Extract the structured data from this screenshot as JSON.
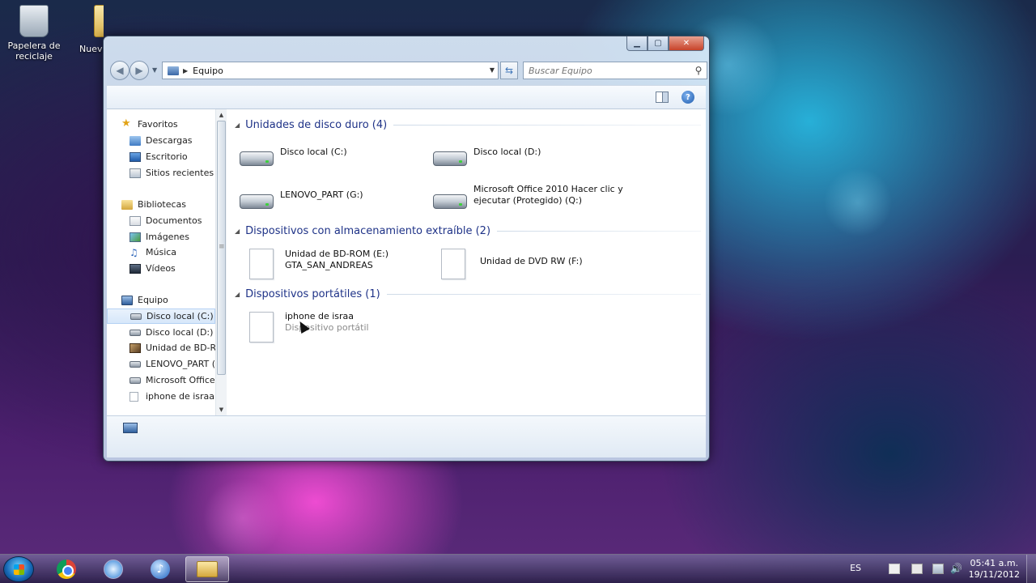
{
  "desktop": {
    "icons": [
      {
        "label": "Papelera de reciclaje"
      },
      {
        "label": "Nuev"
      }
    ]
  },
  "window": {
    "address": {
      "crumb": "Equipo"
    },
    "search": {
      "placeholder": "Buscar Equipo"
    }
  },
  "nav_pane": {
    "favorites": {
      "title": "Favoritos",
      "items": [
        "Descargas",
        "Escritorio",
        "Sitios recientes"
      ]
    },
    "libraries": {
      "title": "Bibliotecas",
      "items": [
        "Documentos",
        "Imágenes",
        "Música",
        "Vídeos"
      ]
    },
    "computer": {
      "title": "Equipo",
      "items": [
        "Disco local (C:)",
        "Disco local (D:)",
        "Unidad de BD-ROM",
        "LENOVO_PART (G:)",
        "Microsoft Office",
        "iphone de israa"
      ]
    }
  },
  "groups": {
    "hard_disks": {
      "title": "Unidades de disco duro (4)",
      "items": [
        {
          "label": "Disco local (C:)"
        },
        {
          "label": "Disco local (D:)"
        },
        {
          "label": "LENOVO_PART (G:)"
        },
        {
          "label1": "Microsoft Office 2010 Hacer clic y",
          "label2": "ejecutar (Protegido) (Q:)"
        }
      ]
    },
    "removable": {
      "title": "Dispositivos con almacenamiento extraíble (2)",
      "items": [
        {
          "label1": "Unidad de BD-ROM (E:)",
          "label2": "GTA_SAN_ANDREAS"
        },
        {
          "label": "Unidad de DVD RW (F:)"
        }
      ]
    },
    "portable": {
      "title": "Dispositivos portátiles (1)",
      "items": [
        {
          "label": "iphone de israa",
          "sub": "Dispositivo portátil"
        }
      ]
    }
  },
  "tray": {
    "language": "ES",
    "time": "05:41 a.m.",
    "date": "19/11/2012"
  },
  "colors": {
    "group_header": "#1e3287",
    "selection": "#d6e7fa"
  }
}
